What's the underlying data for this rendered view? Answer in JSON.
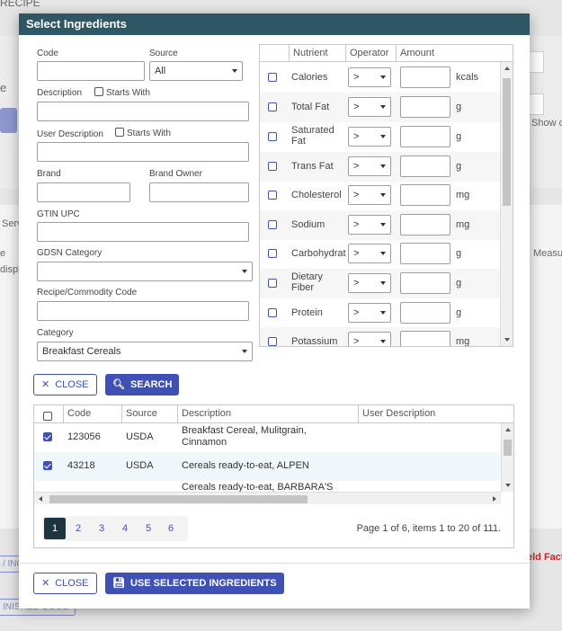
{
  "background": {
    "recipe_crumb": "RECIPE",
    "frag_e": "e",
    "frag_serv": "Serv",
    "frag_show": "Show c",
    "frag_measu": "Measu",
    "frag_displ": "displ",
    "frag_e2": "e",
    "frag_ing": "/ ING",
    "frag_field_fact": "eld Fact",
    "frag_finished": "INISHED GOOD"
  },
  "dialog": {
    "title": "Select Ingredients"
  },
  "form": {
    "code_label": "Code",
    "code_value": "",
    "source_label": "Source",
    "source_value": "All",
    "description_label": "Description",
    "starts_with_label": "Starts With",
    "description_value": "",
    "user_description_label": "User Description",
    "user_starts_with_label": "Starts With",
    "user_description_value": "",
    "brand_label": "Brand",
    "brand_value": "",
    "brand_owner_label": "Brand Owner",
    "brand_owner_value": "",
    "gtin_label": "GTIN UPC",
    "gtin_value": "",
    "gdsn_label": "GDSN Category",
    "gdsn_value": "",
    "recipe_code_label": "Recipe/Commodity Code",
    "recipe_code_value": "",
    "category_label": "Category",
    "category_value": "Breakfast Cereals"
  },
  "nutrients": {
    "headers": {
      "nutrient": "Nutrient",
      "operator": "Operator",
      "amount": "Amount"
    },
    "rows": [
      {
        "name": "Calories",
        "operator": ">",
        "unit": "kcals"
      },
      {
        "name": "Total Fat",
        "operator": ">",
        "unit": "g"
      },
      {
        "name": "Saturated Fat",
        "operator": ">",
        "unit": "g"
      },
      {
        "name": "Trans Fat",
        "operator": ">",
        "unit": "g"
      },
      {
        "name": "Cholesterol",
        "operator": ">",
        "unit": "mg"
      },
      {
        "name": "Sodium",
        "operator": ">",
        "unit": "mg"
      },
      {
        "name": "Carbohydrat",
        "operator": ">",
        "unit": "g"
      },
      {
        "name": "Dietary Fiber",
        "operator": ">",
        "unit": "g"
      },
      {
        "name": "Protein",
        "operator": ">",
        "unit": "g"
      },
      {
        "name": "Potassium",
        "operator": ">",
        "unit": "mg"
      }
    ]
  },
  "actions": {
    "close_label": "CLOSE",
    "search_label": "SEARCH",
    "use_selected_label": "USE SELECTED INGREDIENTS"
  },
  "results": {
    "headers": {
      "code": "Code",
      "source": "Source",
      "description": "Description",
      "user_description": "User Description"
    },
    "rows": [
      {
        "checked": true,
        "code": "123056",
        "source": "USDA",
        "description": "Breakfast Cereal, Mulitgrain, Cinnamon",
        "user_description": ""
      },
      {
        "checked": true,
        "code": "43218",
        "source": "USDA",
        "description": "Cereals ready-to-eat, ALPEN",
        "user_description": ""
      },
      {
        "checked": false,
        "code": "",
        "source": "",
        "description": "Cereals ready-to-eat, BARBARA'S",
        "user_description": ""
      }
    ],
    "pages": [
      "1",
      "2",
      "3",
      "4",
      "5",
      "6"
    ],
    "current_page": "1",
    "page_info": "Page 1 of 6, items 1 to 20 of 111."
  }
}
